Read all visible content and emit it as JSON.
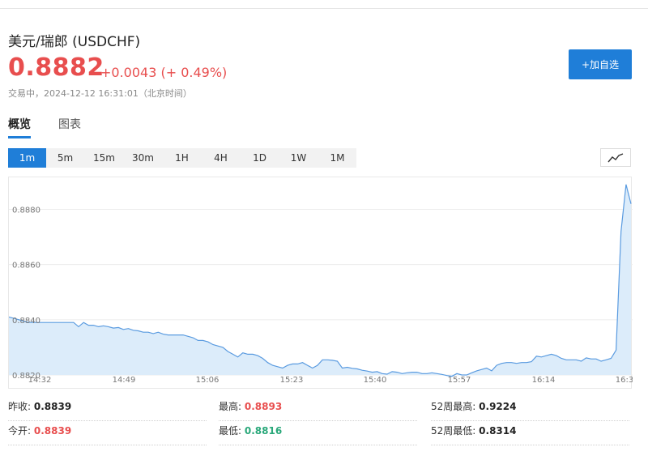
{
  "header": {
    "title": "美元/瑞郎",
    "symbol": "(USDCHF)",
    "price": "0.8882",
    "change": "+0.0043 (+ 0.49%)",
    "status": "交易中，2024-12-12 16:31:01（北京时间）",
    "add_button": "+加自选"
  },
  "tabs": [
    {
      "label": "概览",
      "active": true
    },
    {
      "label": "图表",
      "active": false
    }
  ],
  "ranges": [
    {
      "label": "1m",
      "active": true
    },
    {
      "label": "5m"
    },
    {
      "label": "15m"
    },
    {
      "label": "30m"
    },
    {
      "label": "1H"
    },
    {
      "label": "4H"
    },
    {
      "label": "1D"
    },
    {
      "label": "1W"
    },
    {
      "label": "1M"
    }
  ],
  "chart_data": {
    "type": "area",
    "x_ticks": [
      "14:32",
      "14:49",
      "15:06",
      "15:23",
      "15:40",
      "15:57",
      "16:14",
      "16:3"
    ],
    "y_ticks": [
      "0.8820",
      "0.8840",
      "0.8860",
      "0.8880"
    ],
    "ylim": [
      0.882,
      0.8891
    ],
    "x": [
      0,
      1,
      2,
      3,
      4,
      5,
      6,
      7,
      8,
      9,
      10,
      11,
      12,
      13,
      14,
      15,
      16,
      17,
      18,
      19,
      20,
      21,
      22,
      23,
      24,
      25,
      26,
      27,
      28,
      29,
      30,
      31,
      32,
      33,
      34,
      35,
      36,
      37,
      38,
      39,
      40,
      41,
      42,
      43,
      44,
      45,
      46,
      47,
      48,
      49,
      50,
      51,
      52,
      53,
      54,
      55,
      56,
      57,
      58,
      59,
      60,
      61,
      62,
      63,
      64,
      65,
      66,
      67,
      68,
      69,
      70,
      71,
      72,
      73,
      74,
      75,
      76,
      77,
      78,
      79,
      80,
      81,
      82,
      83,
      84,
      85,
      86,
      87,
      88,
      89,
      90,
      91,
      92,
      93,
      94,
      95,
      96,
      97,
      98,
      99,
      100,
      101,
      102,
      103,
      104,
      105,
      106,
      107,
      108,
      109,
      110,
      111,
      112,
      113,
      114,
      115,
      116,
      117,
      118,
      119,
      120,
      121
    ],
    "values": [
      0.8841,
      0.88405,
      0.884,
      0.88395,
      0.8839,
      0.8839,
      0.8839,
      0.8839,
      0.8839,
      0.8839,
      0.8839,
      0.8839,
      0.8839,
      0.8839,
      0.88375,
      0.8839,
      0.8838,
      0.8838,
      0.88375,
      0.88378,
      0.88375,
      0.8837,
      0.88372,
      0.88365,
      0.88368,
      0.88362,
      0.8836,
      0.88355,
      0.88355,
      0.8835,
      0.88355,
      0.88348,
      0.88345,
      0.88345,
      0.88345,
      0.88345,
      0.8834,
      0.88335,
      0.88325,
      0.88325,
      0.8832,
      0.8831,
      0.88305,
      0.883,
      0.88285,
      0.88275,
      0.88265,
      0.8828,
      0.88275,
      0.88275,
      0.8827,
      0.8826,
      0.88245,
      0.88235,
      0.8823,
      0.88225,
      0.88235,
      0.8824,
      0.8824,
      0.88245,
      0.88235,
      0.88225,
      0.88235,
      0.88255,
      0.88255,
      0.88253,
      0.8825,
      0.88225,
      0.88228,
      0.88224,
      0.88222,
      0.88217,
      0.88214,
      0.8821,
      0.88212,
      0.88205,
      0.88203,
      0.88212,
      0.8821,
      0.88205,
      0.88208,
      0.8821,
      0.8821,
      0.88205,
      0.88205,
      0.88208,
      0.88205,
      0.88202,
      0.88198,
      0.88195,
      0.88205,
      0.882,
      0.882,
      0.88208,
      0.88215,
      0.8822,
      0.88225,
      0.88215,
      0.88235,
      0.88242,
      0.88245,
      0.88245,
      0.88242,
      0.88245,
      0.88245,
      0.88248,
      0.88268,
      0.88265,
      0.8827,
      0.88275,
      0.8827,
      0.8826,
      0.88255,
      0.88255,
      0.88255,
      0.8825,
      0.88262,
      0.88258,
      0.88258,
      0.8825,
      0.88255,
      0.8826,
      0.8829,
      0.8872,
      0.8889,
      0.8882
    ]
  },
  "stats": [
    {
      "label": "昨收:",
      "value": "0.8839",
      "tone": "neutral"
    },
    {
      "label": "最高:",
      "value": "0.8893",
      "tone": "up"
    },
    {
      "label": "52周最高:",
      "value": "0.9224",
      "tone": "neutral"
    },
    {
      "label": "今开:",
      "value": "0.8839",
      "tone": "up"
    },
    {
      "label": "最低:",
      "value": "0.8816",
      "tone": "down"
    },
    {
      "label": "52周最低:",
      "value": "0.8314",
      "tone": "neutral"
    }
  ],
  "colors": {
    "accent": "#1f7ed8",
    "up": "#e84e4e",
    "down": "#2aa87a",
    "line": "#5a9be0",
    "fill": "#dcecfa"
  }
}
